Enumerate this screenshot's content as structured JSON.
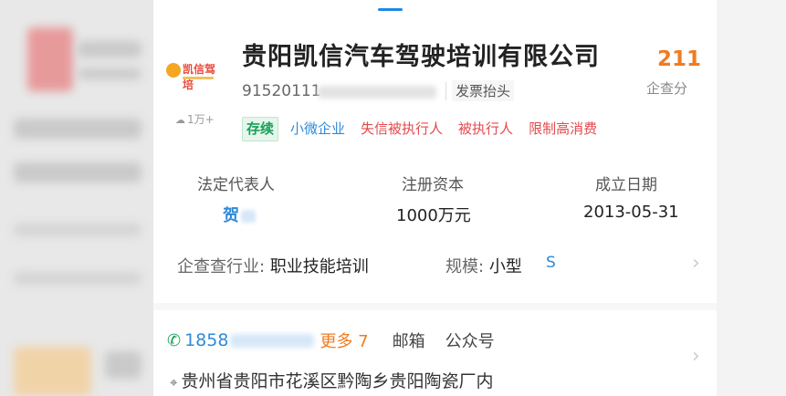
{
  "company": {
    "name": "贵阳凯信汽车驾驶培训有限公司",
    "logo_text": "凯信驾培",
    "credit_code_prefix": "91520111",
    "invoice_label": "发票抬头",
    "views": "1万+"
  },
  "score": {
    "value": "211",
    "label": "企查分"
  },
  "tags": [
    "存续",
    "小微企业",
    "失信被执行人",
    "被执行人",
    "限制高消费"
  ],
  "stats": {
    "legal_rep_label": "法定代表人",
    "legal_rep_value": "贺",
    "capital_label": "注册资本",
    "capital_value": "1000万元",
    "founded_label": "成立日期",
    "founded_value": "2013-05-31"
  },
  "industry": {
    "label": "企查查行业:",
    "value": "职业技能培训",
    "scale_label": "规模:",
    "scale_value": "小型",
    "scale_badge": "S"
  },
  "contact": {
    "phone_prefix": "1858",
    "more_label": "更多 7",
    "email_label": "邮箱",
    "wechat_label": "公众号"
  },
  "address": "贵州省贵阳市花溪区黔陶乡贵阳陶瓷厂内"
}
